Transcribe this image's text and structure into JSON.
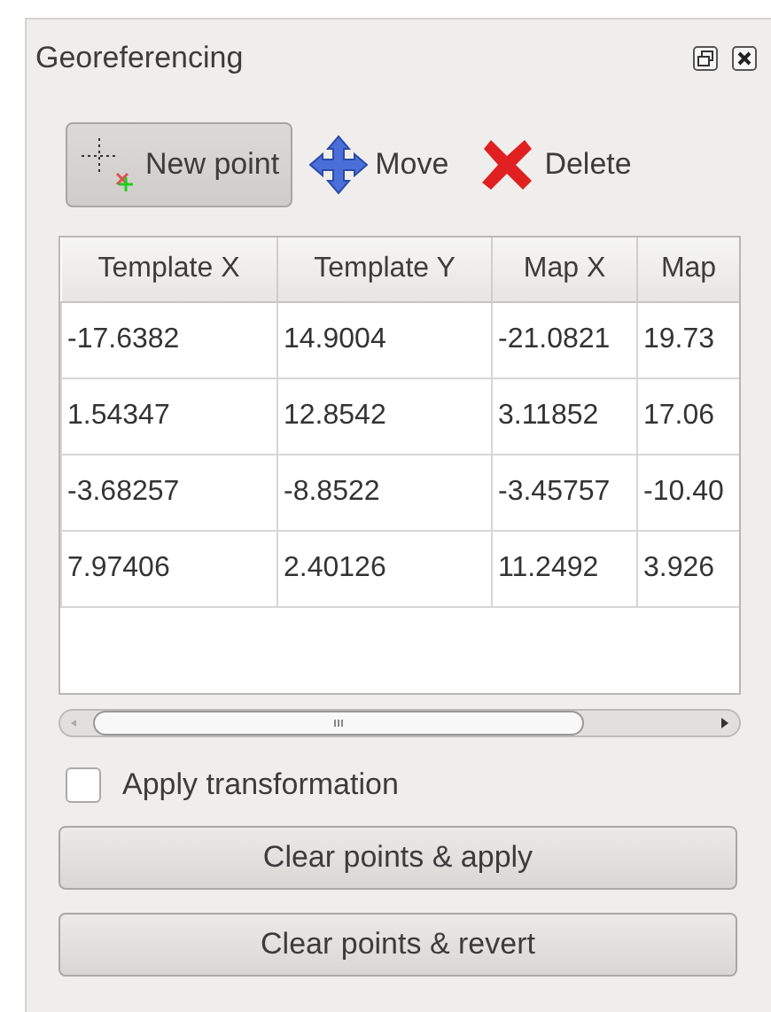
{
  "panel": {
    "title": "Georeferencing"
  },
  "tools": [
    {
      "kind": "new",
      "label": "New point",
      "selected": true
    },
    {
      "kind": "move",
      "label": "Move",
      "selected": false
    },
    {
      "kind": "delete",
      "label": "Delete",
      "selected": false
    }
  ],
  "table": {
    "columns": [
      "Template X",
      "Template Y",
      "Map X",
      "Map"
    ],
    "rows": [
      [
        "-17.6382",
        "14.9004",
        "-21.0821",
        "19.73"
      ],
      [
        "1.54347",
        "12.8542",
        "3.11852",
        "17.06"
      ],
      [
        "-3.68257",
        "-8.8522",
        "-3.45757",
        "-10.40"
      ],
      [
        "7.97406",
        "2.40126",
        "11.2492",
        "3.926"
      ]
    ]
  },
  "apply_transformation": {
    "label": "Apply transformation",
    "checked": false
  },
  "buttons": [
    "Clear points & apply",
    "Clear points & revert"
  ]
}
